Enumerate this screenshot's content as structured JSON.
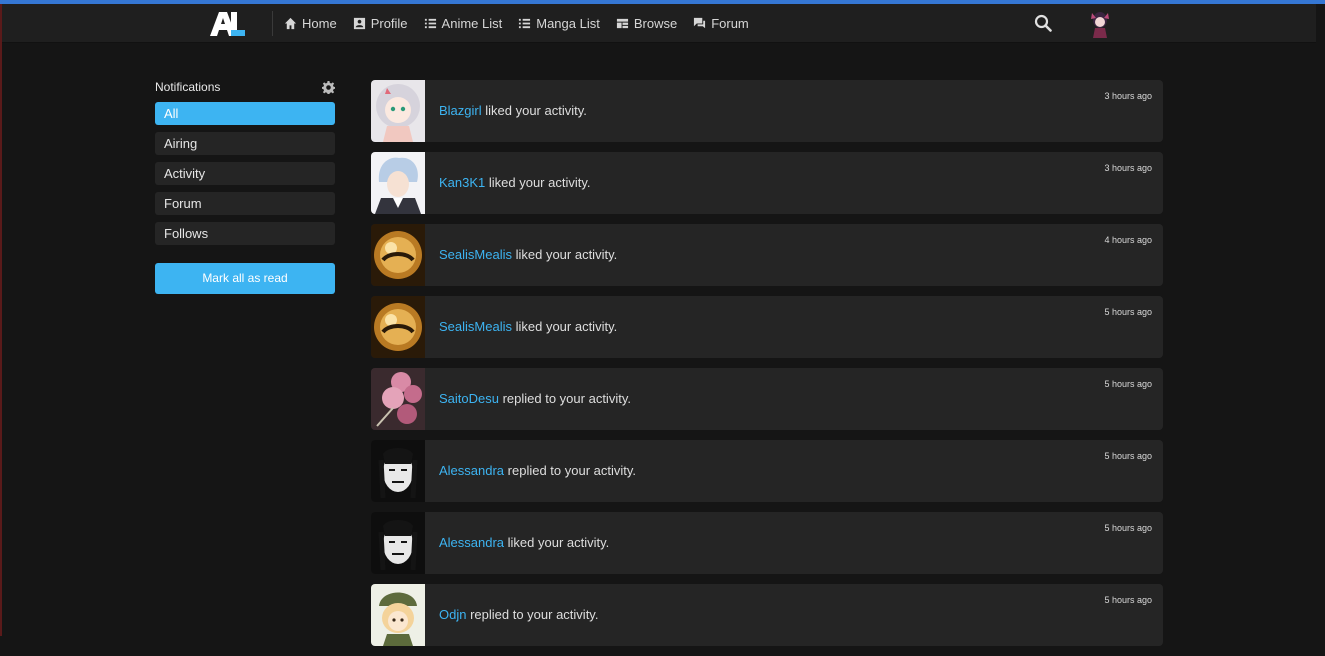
{
  "nav": {
    "items": [
      {
        "label": "Home",
        "icon": "home-icon"
      },
      {
        "label": "Profile",
        "icon": "profile-icon"
      },
      {
        "label": "Anime List",
        "icon": "list-icon"
      },
      {
        "label": "Manga List",
        "icon": "list-icon"
      },
      {
        "label": "Browse",
        "icon": "browse-icon"
      },
      {
        "label": "Forum",
        "icon": "forum-icon"
      }
    ]
  },
  "sidebar": {
    "title": "Notifications",
    "filters": [
      {
        "label": "All",
        "active": true
      },
      {
        "label": "Airing"
      },
      {
        "label": "Activity"
      },
      {
        "label": "Forum"
      },
      {
        "label": "Follows"
      }
    ],
    "mark_all_label": "Mark all as read"
  },
  "notifications": [
    {
      "user": "Blazgirl",
      "text": " liked your activity.",
      "time": "3 hours ago"
    },
    {
      "user": "Kan3K1",
      "text": " liked your activity.",
      "time": "3 hours ago"
    },
    {
      "user": "SealisMealis",
      "text": " liked your activity.",
      "time": "4 hours ago"
    },
    {
      "user": "SealisMealis",
      "text": " liked your activity.",
      "time": "5 hours ago"
    },
    {
      "user": "SaitoDesu",
      "text": " replied to your activity.",
      "time": "5 hours ago"
    },
    {
      "user": "Alessandra",
      "text": " replied to your activity.",
      "time": "5 hours ago"
    },
    {
      "user": "Alessandra",
      "text": " liked your activity.",
      "time": "5 hours ago"
    },
    {
      "user": "Odjn",
      "text": " replied to your activity.",
      "time": "5 hours ago"
    }
  ],
  "colors": {
    "accent": "#3db4f2",
    "background": "#151515",
    "card": "#252525",
    "topbar": "#3577d4"
  }
}
